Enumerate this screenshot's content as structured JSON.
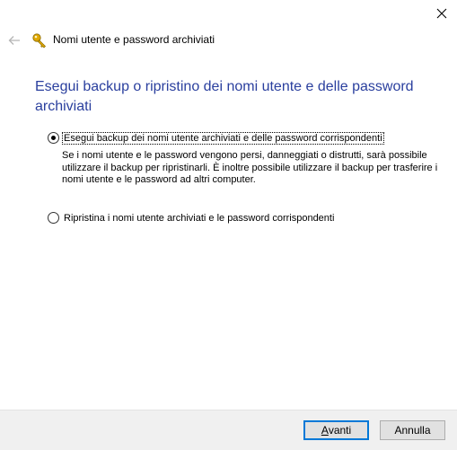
{
  "window": {
    "title": "Nomi utente e password archiviati",
    "close_glyph": "✕",
    "back_glyph": "←"
  },
  "heading": "Esegui backup o ripristino dei nomi utente e delle password archiviati",
  "options": [
    {
      "label": "Esegui backup dei nomi utente archiviati e delle password corrispondenti",
      "selected": true,
      "description": "Se i nomi utente e le password vengono persi, danneggiati o distrutti, sarà possibile utilizzare il backup per ripristinarli. È inoltre possibile utilizzare il backup per trasferire i nomi utente e le password ad altri computer."
    },
    {
      "label": "Ripristina i nomi utente archiviati e le password corrispondenti",
      "selected": false
    }
  ],
  "buttons": {
    "next_accel": "A",
    "next_rest": "vanti",
    "cancel": "Annulla"
  },
  "colors": {
    "heading": "#2a3f9e",
    "primary_border": "#0078d7",
    "footer_bg": "#f0f0f0"
  },
  "icons": {
    "title_icon": "key-icon",
    "back": "back-arrow-icon",
    "close": "close-icon"
  }
}
